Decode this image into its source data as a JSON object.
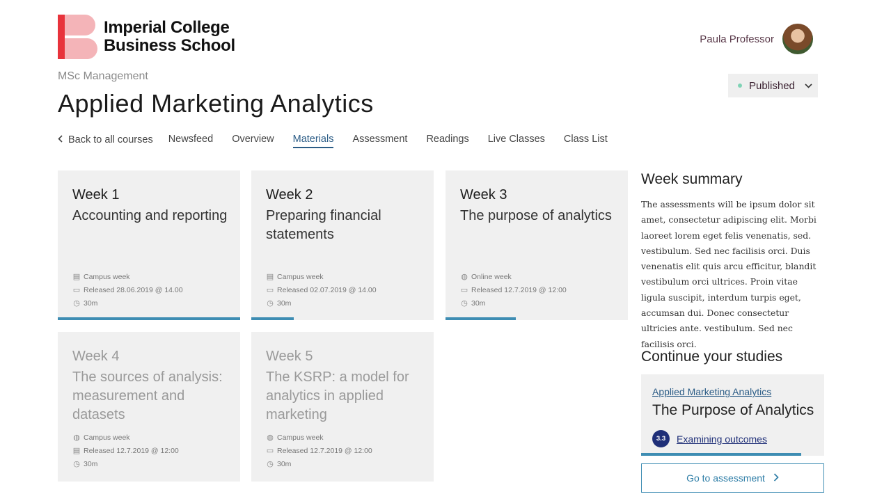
{
  "brand": {
    "logo_text_line1": "Imperial College",
    "logo_text_line2": "Business School",
    "colors": {
      "logo_red": "#e8333b",
      "logo_pink": "#f4b4b8",
      "accent_blue": "#3e8db3",
      "link_blue": "#2b5c86",
      "badge_navy": "#1f2f78",
      "published_dot": "#7fd3b5"
    }
  },
  "user": {
    "name": "Paula Professor",
    "avatar_icon": "user-avatar"
  },
  "course": {
    "program": "MSc Management",
    "title": "Applied Marketing Analytics"
  },
  "status": {
    "label": "Published",
    "dot_icon": "status-dot-icon",
    "chevron_icon": "chevron-down-icon"
  },
  "nav": {
    "back_label": "Back to all courses",
    "tabs": [
      {
        "label": "Newsfeed",
        "active": false
      },
      {
        "label": "Overview",
        "active": false
      },
      {
        "label": "Materials",
        "active": true
      },
      {
        "label": "Assessment",
        "active": false
      },
      {
        "label": "Readings",
        "active": false
      },
      {
        "label": "Live Classes",
        "active": false
      },
      {
        "label": "Class List",
        "active": false
      }
    ]
  },
  "weeks": [
    {
      "week": "Week 1",
      "title": "Accounting and reporting",
      "type": "Campus week",
      "type_icon": "building-icon",
      "released": "Released 28.06.2019 @ 14.00",
      "duration": "30m",
      "progress": 1.0,
      "dimmed": false
    },
    {
      "week": "Week 2",
      "title": "Preparing financial statements",
      "type": "Campus week",
      "type_icon": "building-icon",
      "released": "Released 02.07.2019 @ 14.00",
      "duration": "30m",
      "progress": 0.23,
      "dimmed": false
    },
    {
      "week": "Week 3",
      "title": "The purpose of analytics",
      "type": "Online week",
      "type_icon": "globe-icon",
      "released": "Released 12.7.2019 @ 12:00",
      "duration": "30m",
      "progress": 0.39,
      "dimmed": false
    },
    {
      "week": "Week 4",
      "title": "The sources of analysis: measurement and datasets",
      "type": "Campus week",
      "type_icon": "globe-icon",
      "released": "Released 12.7.2019 @ 12:00",
      "duration": "30m",
      "progress": 0,
      "dimmed": true
    },
    {
      "week": "Week 5",
      "title": "The KSRP: a model for analytics in applied marketing",
      "type": "Campus week",
      "type_icon": "globe-icon",
      "released": "Released 12.7.2019 @ 12:00",
      "duration": "30m",
      "progress": 0,
      "dimmed": true
    }
  ],
  "sidebar": {
    "summary_heading": "Week summary",
    "summary_text": "The assessments will be ipsum dolor sit amet, consectetur adipiscing elit. Morbi laoreet lorem eget felis venenatis, sed. vestibulum. Sed nec facilisis orci. Duis venenatis elit quis arcu efficitur, blandit vestibulum orci ultrices. Proin vitae ligula suscipit, interdum turpis eget, accumsan dui. Donec consectetur ultricies ante. vestibulum. Sed nec facilisis orci.",
    "continue_heading": "Continue your studies",
    "continue": {
      "course_link": "Applied Marketing Analytics",
      "title": "The Purpose of Analytics",
      "badge": "3.3",
      "sub_link": "Examining outcomes",
      "progress": 0.87
    },
    "go_button_label": "Go to assessment"
  }
}
